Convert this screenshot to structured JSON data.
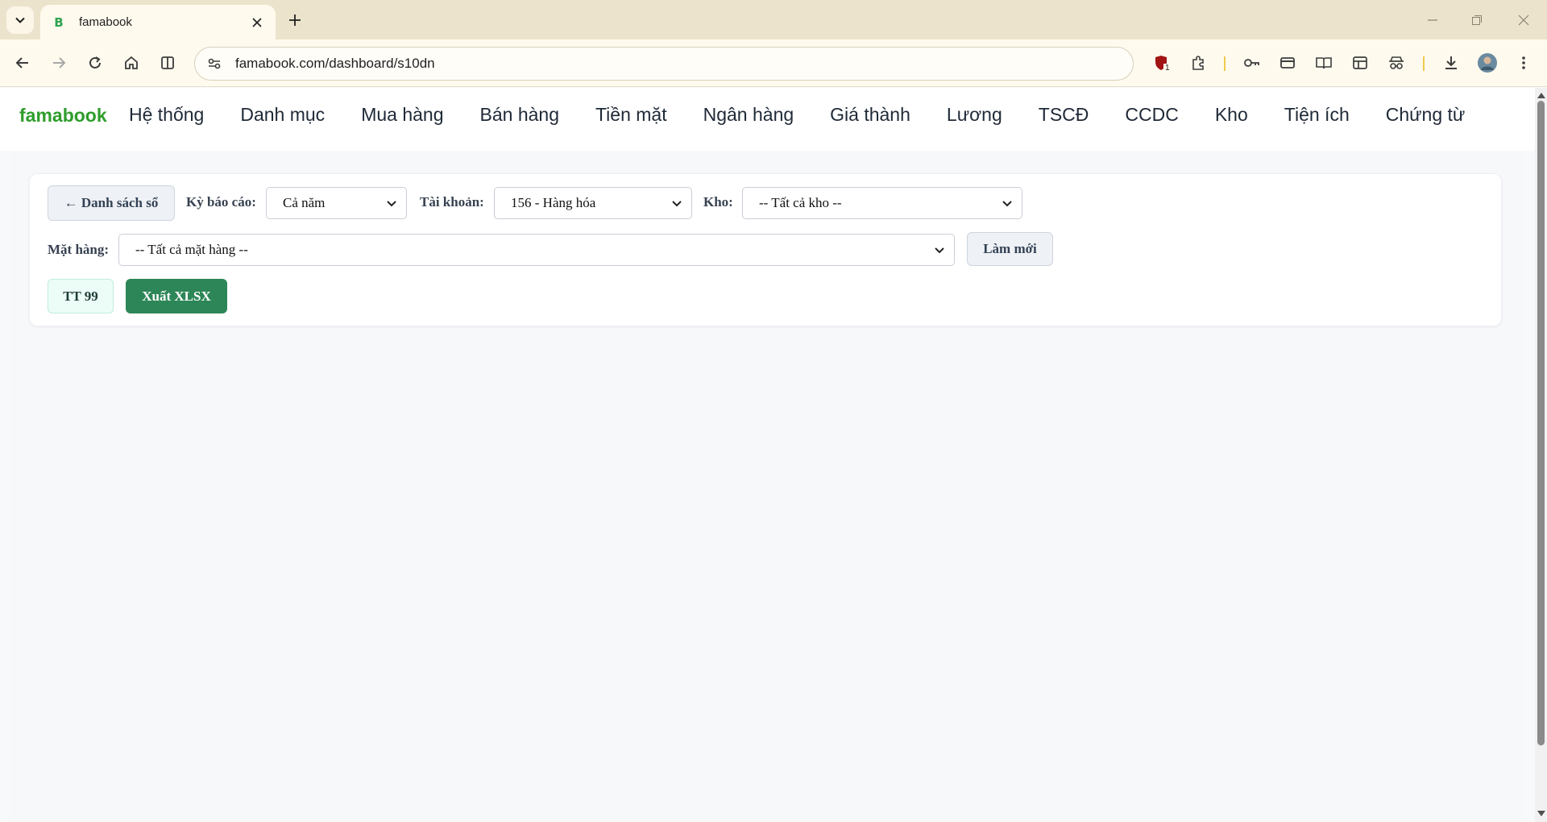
{
  "browser": {
    "tab_title": "famabook",
    "tab_favicon_letter": "B",
    "url": "famabook.com/dashboard/s10dn",
    "extension_badge": "1"
  },
  "nav": {
    "brand": "famabook",
    "items": [
      "Hệ thống",
      "Danh mục",
      "Mua hàng",
      "Bán hàng",
      "Tiền mặt",
      "Ngân hàng",
      "Giá thành",
      "Lương",
      "TSCĐ",
      "CCDC",
      "Kho",
      "Tiện ích",
      "Chứng từ"
    ]
  },
  "filters": {
    "back_label": "← Danh sách sổ",
    "period_label": "Kỳ báo cáo:",
    "period_value": "Cả năm",
    "account_label": "Tài khoản:",
    "account_value": "156 - Hàng hóa",
    "warehouse_label": "Kho:",
    "warehouse_value": "-- Tất cả kho --",
    "item_label": "Mặt hàng:",
    "item_value": "-- Tất cả mặt hàng --",
    "refresh_label": "Làm mới",
    "tt99_label": "TT 99",
    "export_label": "Xuất XLSX"
  },
  "colors": {
    "brand": "#2e9d2b",
    "export_button": "#2d8657",
    "tab_strip": "#ece3cc",
    "toolbar": "#fffaee"
  }
}
